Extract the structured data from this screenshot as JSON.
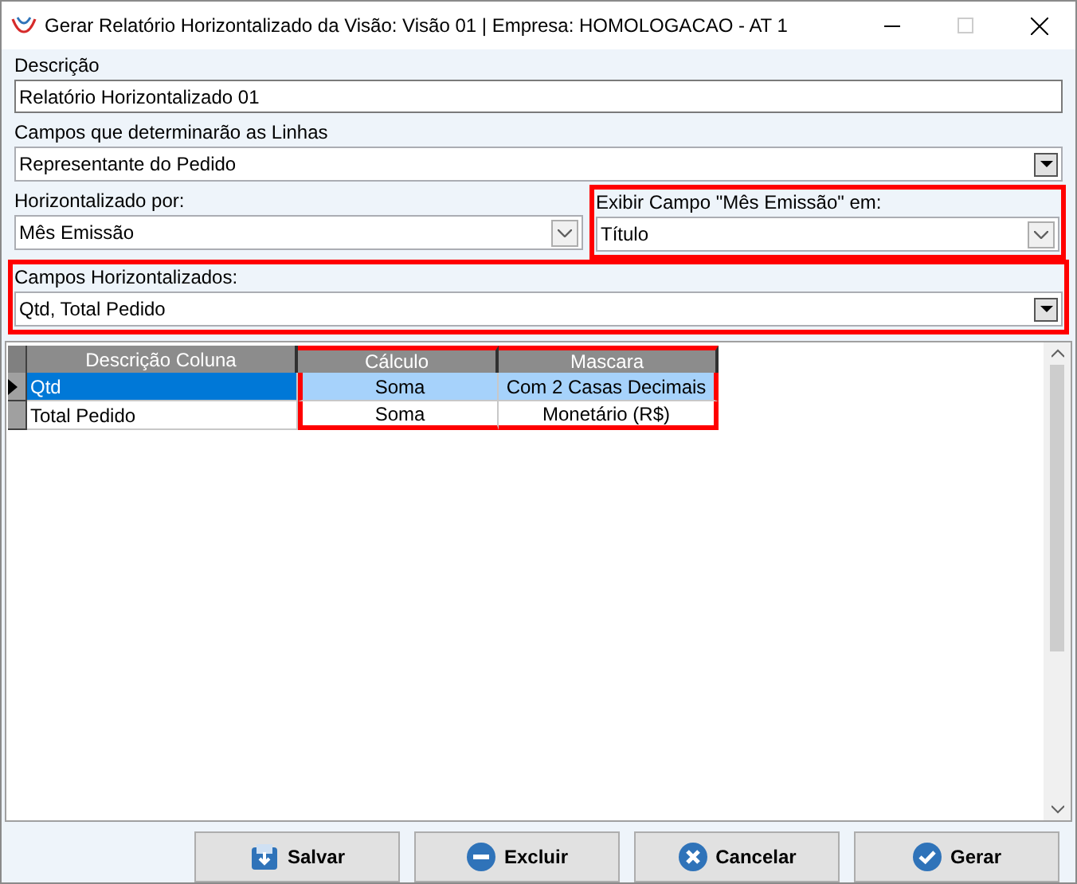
{
  "window": {
    "title": "Gerar Relatório Horizontalizado da Visão: Visão 01 | Empresa: HOMOLOGACAO - AT 1"
  },
  "descricao": {
    "label": "Descrição",
    "value": "Relatório Horizontalizado 01"
  },
  "linhas": {
    "label": "Campos que determinarão as Linhas",
    "value": "Representante do Pedido",
    "highlighted": false
  },
  "horizontalizado_por": {
    "label": "Horizontalizado por:",
    "value": "Mês Emissão",
    "highlighted": false
  },
  "exibir_campo": {
    "label": "Exibir Campo \"Mês Emissão\" em:",
    "value": "Título",
    "highlighted": true
  },
  "campos_horizontalizados": {
    "label": "Campos Horizontalizados:",
    "value": "Qtd, Total Pedido",
    "highlighted": true
  },
  "grid": {
    "columns": [
      {
        "label": "Descrição Coluna",
        "highlighted": false
      },
      {
        "label": "Cálculo",
        "highlighted": true
      },
      {
        "label": "Mascara",
        "highlighted": true
      }
    ],
    "rows": [
      {
        "cells": [
          "Qtd",
          "Soma",
          "Com 2 Casas Decimais"
        ],
        "selected": true
      },
      {
        "cells": [
          "Total Pedido",
          "Soma",
          "Monetário (R$)"
        ],
        "selected": false
      }
    ]
  },
  "buttons": [
    {
      "kind": "save",
      "label": "Salvar"
    },
    {
      "kind": "delete",
      "label": "Excluir"
    },
    {
      "kind": "cancel",
      "label": "Cancelar"
    },
    {
      "kind": "confirm",
      "label": "Gerar"
    }
  ]
}
